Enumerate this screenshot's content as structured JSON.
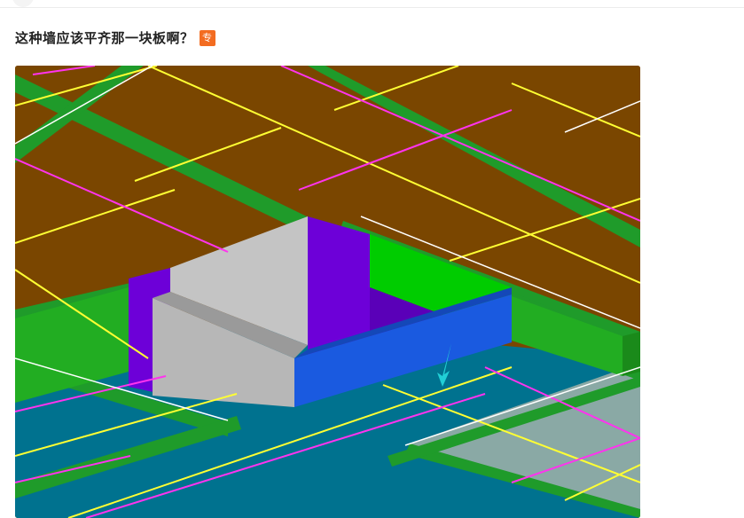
{
  "question": {
    "title": "这种墙应该平齐那一块板啊？",
    "badge": "专"
  },
  "colors": {
    "floor_slab": "#7a4600",
    "lower_slab": "#00728f",
    "beam": "#1f9b2a",
    "wall_grey": "#c4c4c4",
    "wall_purple": "#6d00d8",
    "wall_green": "#00cc00",
    "wall_blue": "#1a5ae0",
    "rebar_yellow": "#ffff33",
    "rebar_magenta": "#ff33ee",
    "pointer": "#21cfd6",
    "pale_slab": "#8aa9a5"
  },
  "figure": {
    "icon": "3d-model-screenshot",
    "pointer_icon": "cyan-arrow-icon"
  }
}
